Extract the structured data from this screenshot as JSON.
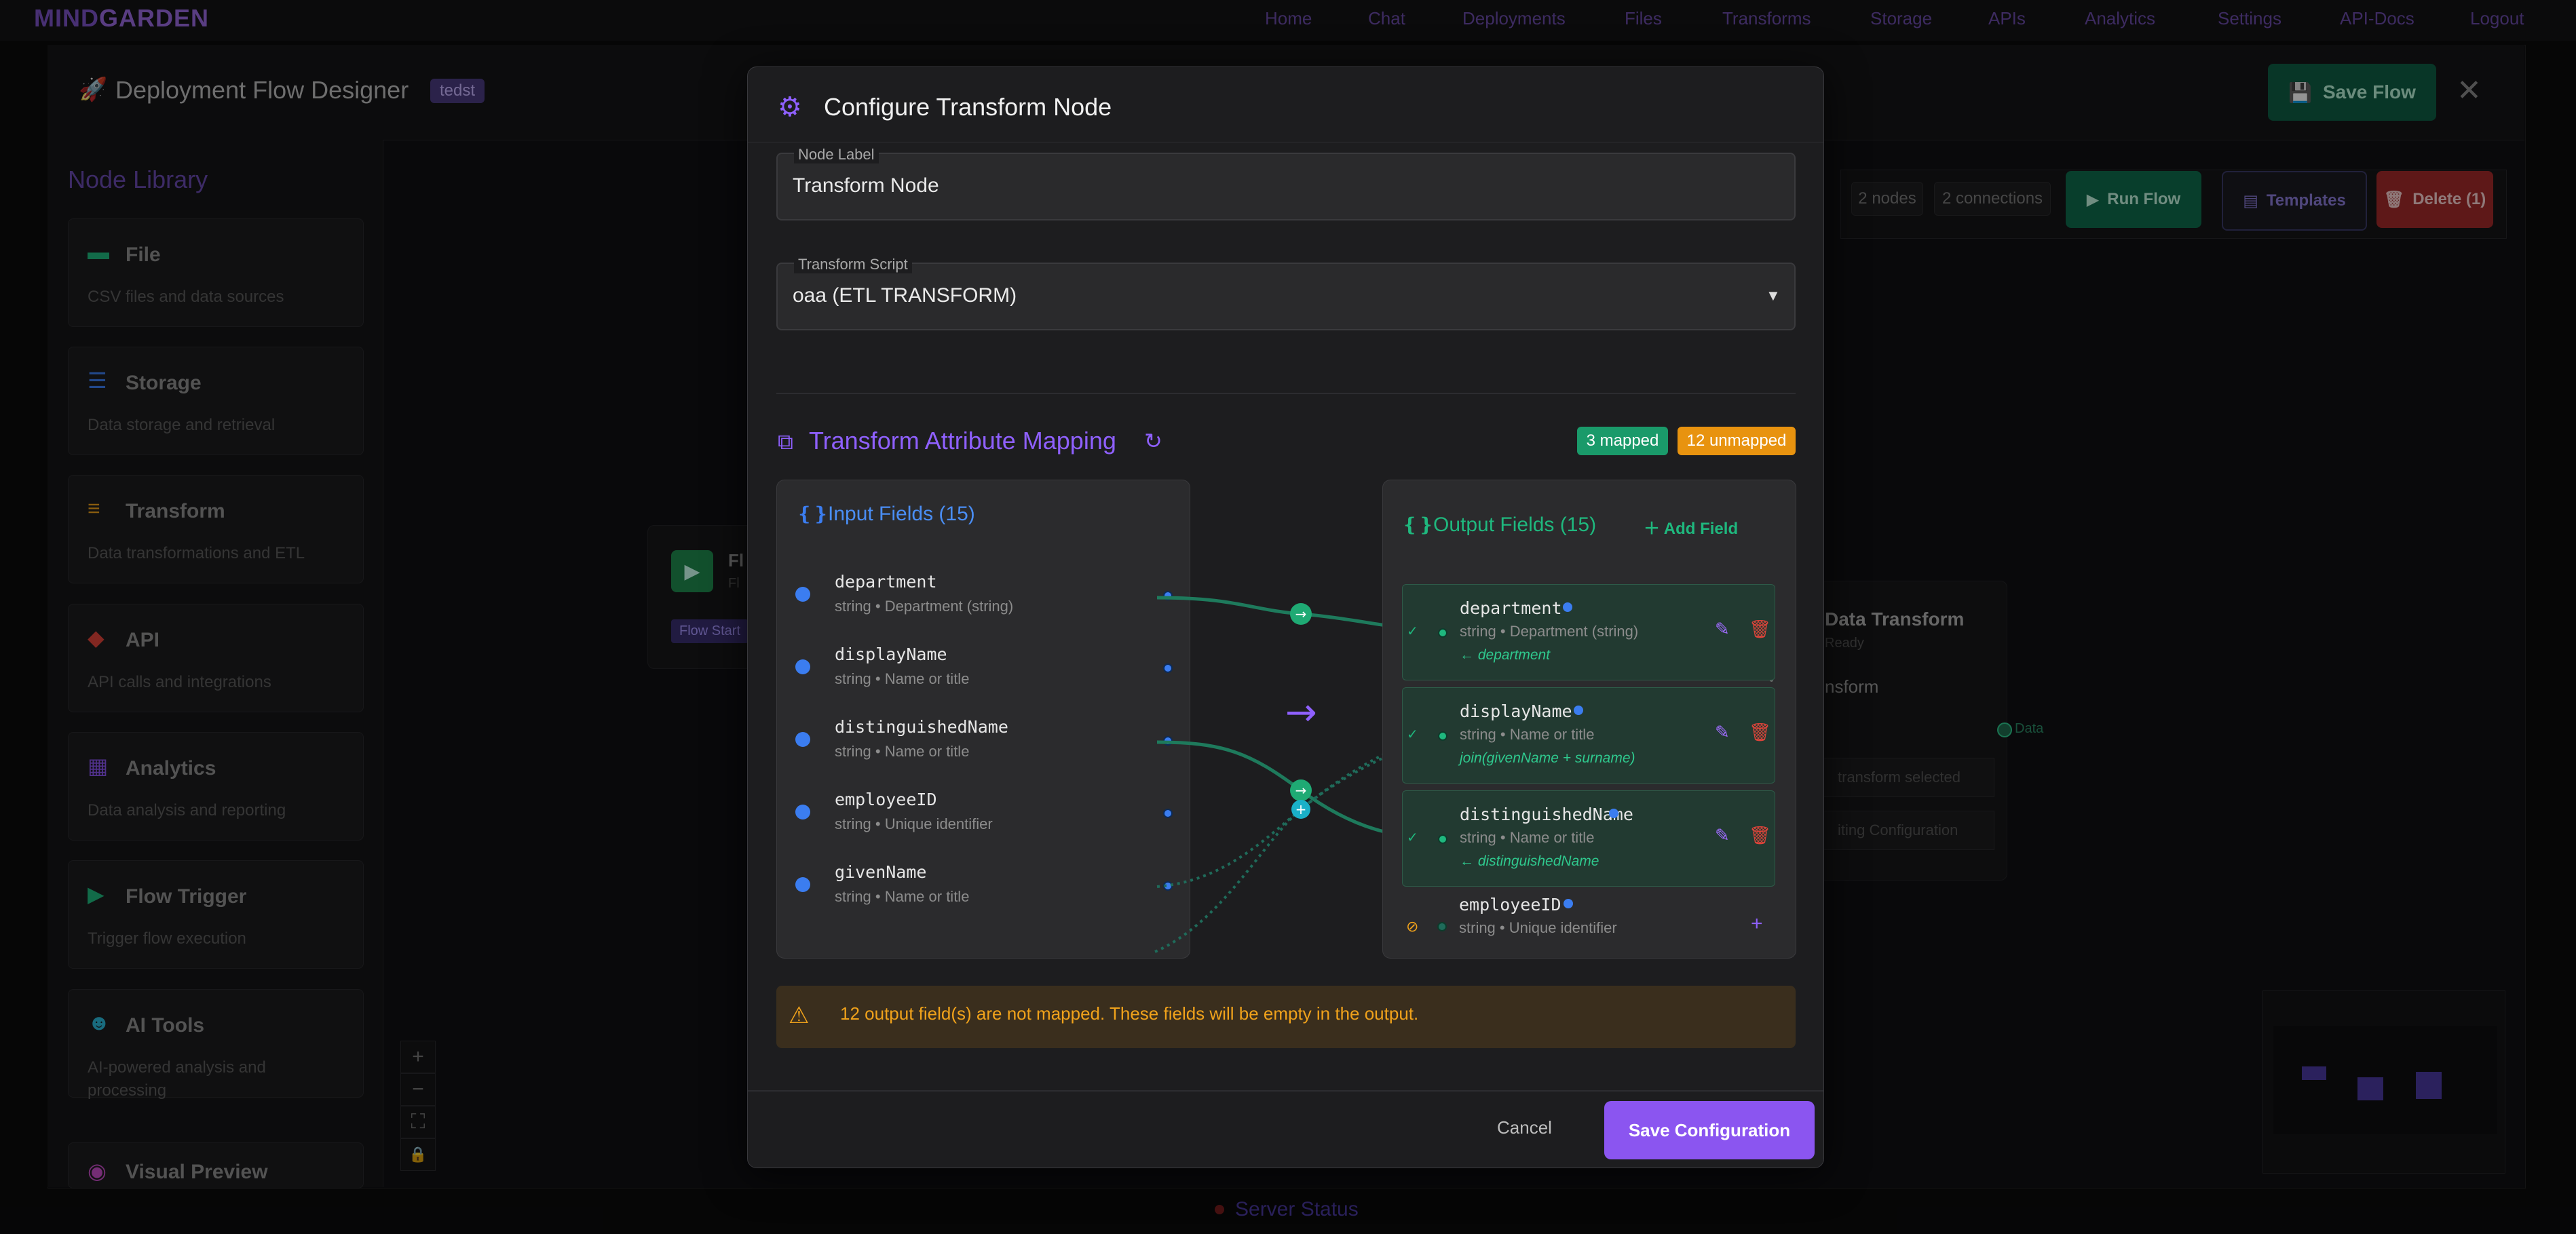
{
  "app": {
    "brand_a": "MIND",
    "brand_b": "GARDEN",
    "nav": [
      "Home",
      "Chat",
      "Deployments",
      "Files",
      "Transforms",
      "Storage",
      "APIs",
      "Analytics",
      "Settings",
      "API-Docs",
      "Logout"
    ]
  },
  "designer": {
    "title": "Deployment Flow Designer",
    "tag": "tedst",
    "save_flow": "Save Flow",
    "library_title": "Node Library",
    "library": [
      {
        "name": "File",
        "desc": "CSV files and data sources",
        "icon": "folder-icon",
        "color": "#1fb87e"
      },
      {
        "name": "Storage",
        "desc": "Data storage and retrieval",
        "icon": "storage-icon",
        "color": "#3b7df0"
      },
      {
        "name": "Transform",
        "desc": "Data transformations and ETL",
        "icon": "filter-icon",
        "color": "#f0a21b"
      },
      {
        "name": "API",
        "desc": "API calls and integrations",
        "icon": "api-icon",
        "color": "#e0443a"
      },
      {
        "name": "Analytics",
        "desc": "Data analysis and reporting",
        "icon": "analytics-icon",
        "color": "#8b55f0"
      },
      {
        "name": "Flow Trigger",
        "desc": "Trigger flow execution",
        "icon": "play-icon",
        "color": "#1fb87e"
      },
      {
        "name": "AI Tools",
        "desc": "AI-powered analysis and processing",
        "icon": "robot-icon",
        "color": "#2bb8d9"
      },
      {
        "name": "Visual Preview",
        "desc": "",
        "icon": "eye-icon",
        "color": "#c94ec9"
      }
    ],
    "toolbar": {
      "nodes": "2 nodes",
      "connections": "2 connections",
      "run": "Run Flow",
      "templates": "Templates",
      "delete": "Delete (1)"
    },
    "node_start": {
      "title": "Fl",
      "sub": "Fl",
      "tag": "Flow Start"
    },
    "node_transform": {
      "title": "Data Transform",
      "status": "Ready",
      "label": "nsform",
      "port": "Data",
      "hint1": "transform selected",
      "hint2": "iting Configuration"
    },
    "server_status": "Server Status",
    "canvas_controls": [
      "+",
      "−",
      "⛶",
      "🔒"
    ]
  },
  "modal": {
    "title": "Configure Transform Node",
    "node_label_label": "Node Label",
    "node_label_value": "Transform Node",
    "script_label": "Transform Script",
    "script_value": "oaa (ETL TRANSFORM)",
    "mapping_title": "Transform Attribute Mapping",
    "mapped_badge": "3 mapped",
    "unmapped_badge": "12 unmapped",
    "input_title": "Input Fields (15)",
    "output_title": "Output Fields (15)",
    "add_field": "Add Field",
    "inputs": [
      {
        "name": "department",
        "sub": "string • Department (string)"
      },
      {
        "name": "displayName",
        "sub": "string • Name or title"
      },
      {
        "name": "distinguishedName",
        "sub": "string • Name or title"
      },
      {
        "name": "employeeID",
        "sub": "string • Unique identifier"
      },
      {
        "name": "givenName",
        "sub": "string • Name or title"
      }
    ],
    "outputs": [
      {
        "name": "department",
        "sub": "string • Department (string)",
        "map": "← department",
        "mapped": true
      },
      {
        "name": "displayName",
        "sub": "string • Name or title",
        "map": "join(givenName + surname)",
        "mapped": true
      },
      {
        "name": "distinguishedName",
        "sub": "string • Name or title",
        "map": "← distinguishedName",
        "mapped": true
      },
      {
        "name": "employeeID",
        "sub": "string • Unique identifier",
        "map": "",
        "mapped": false
      }
    ],
    "warning": "12 output field(s) are not mapped. These fields will be empty in the output.",
    "cancel": "Cancel",
    "save": "Save Configuration"
  }
}
